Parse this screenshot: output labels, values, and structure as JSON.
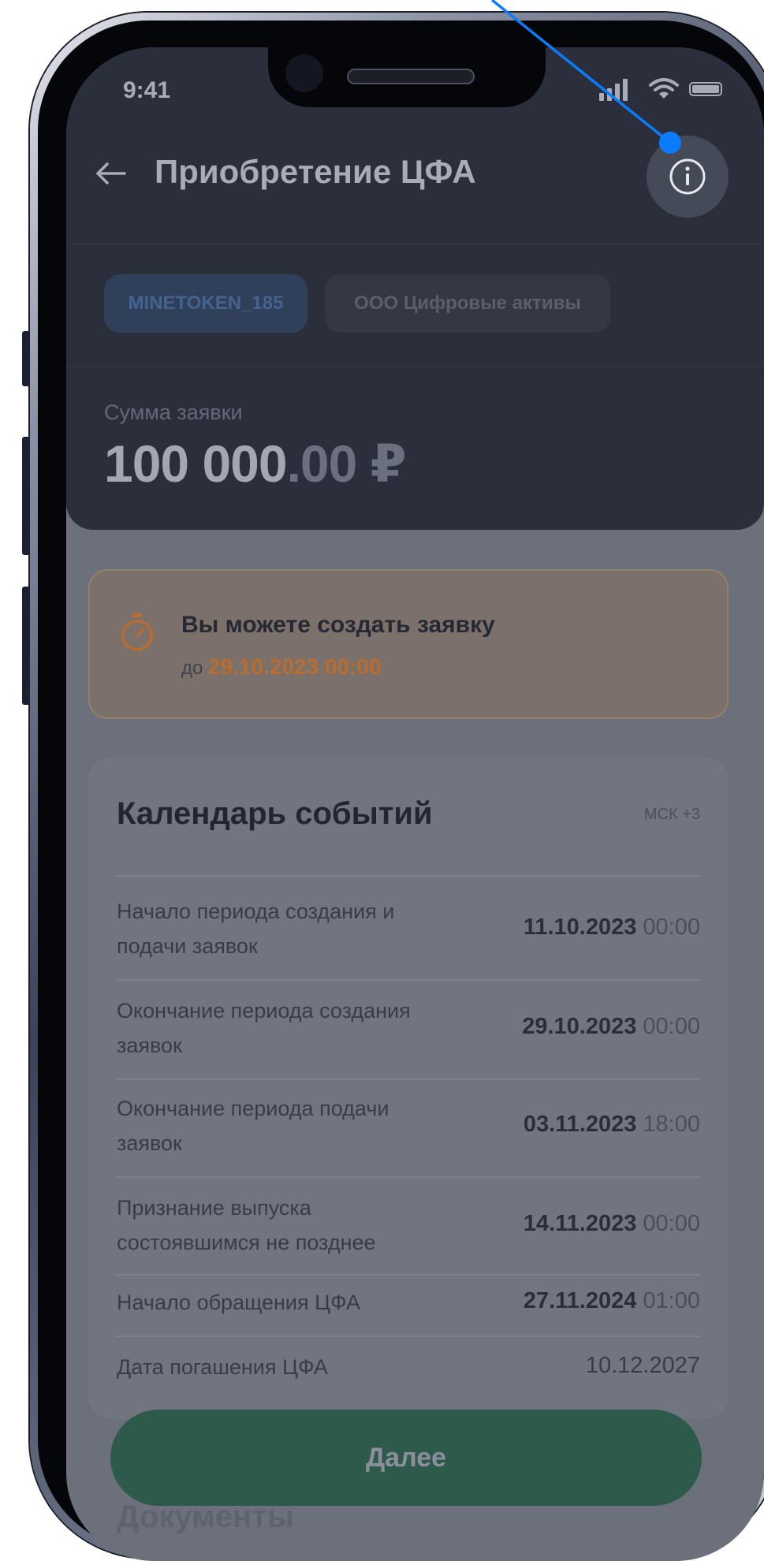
{
  "status_bar": {
    "time": "9:41"
  },
  "header": {
    "title": "Приобретение ЦФА",
    "back_icon": "arrow-left-icon",
    "info_icon": "info-circle-icon"
  },
  "chips": {
    "token": "MINETOKEN_185",
    "issuer": "ООО Цифровые активы"
  },
  "amount": {
    "label": "Сумма заявки",
    "integer": "100 000",
    "decimal": ".00 ₽"
  },
  "deadline": {
    "icon": "stopwatch-icon",
    "title": "Вы можете создать заявку",
    "prefix": "до",
    "datetime": "29.10.2023 00:00"
  },
  "calendar": {
    "title": "Календарь событий",
    "timezone": "МСК +3",
    "events": [
      {
        "label": "Начало периода создания и подачи заявок",
        "date": "11.10.2023",
        "time": "00:00"
      },
      {
        "label": "Окончание периода создания заявок",
        "date": "29.10.2023",
        "time": "00:00"
      },
      {
        "label": "Окончание периода подачи заявок",
        "date": "03.11.2023",
        "time": "18:00"
      },
      {
        "label": "Признание выпуска состоявшимся не позднее",
        "date": "14.11.2023",
        "time": "00:00"
      },
      {
        "label": "Начало обращения ЦФА",
        "date": "27.11.2024",
        "time": "01:00"
      },
      {
        "label": "Дата погашения ЦФА",
        "date": "10.12.2027",
        "time": ""
      }
    ]
  },
  "documents": {
    "title": "Документы"
  },
  "footer": {
    "next_label": "Далее"
  },
  "colors": {
    "header_bg": "#2b2f3b",
    "overlay_bg": "#6c707b",
    "accent_blue": "#0a7cff",
    "accent_orange": "#b96d30",
    "button_green": "#2d5a4a"
  }
}
